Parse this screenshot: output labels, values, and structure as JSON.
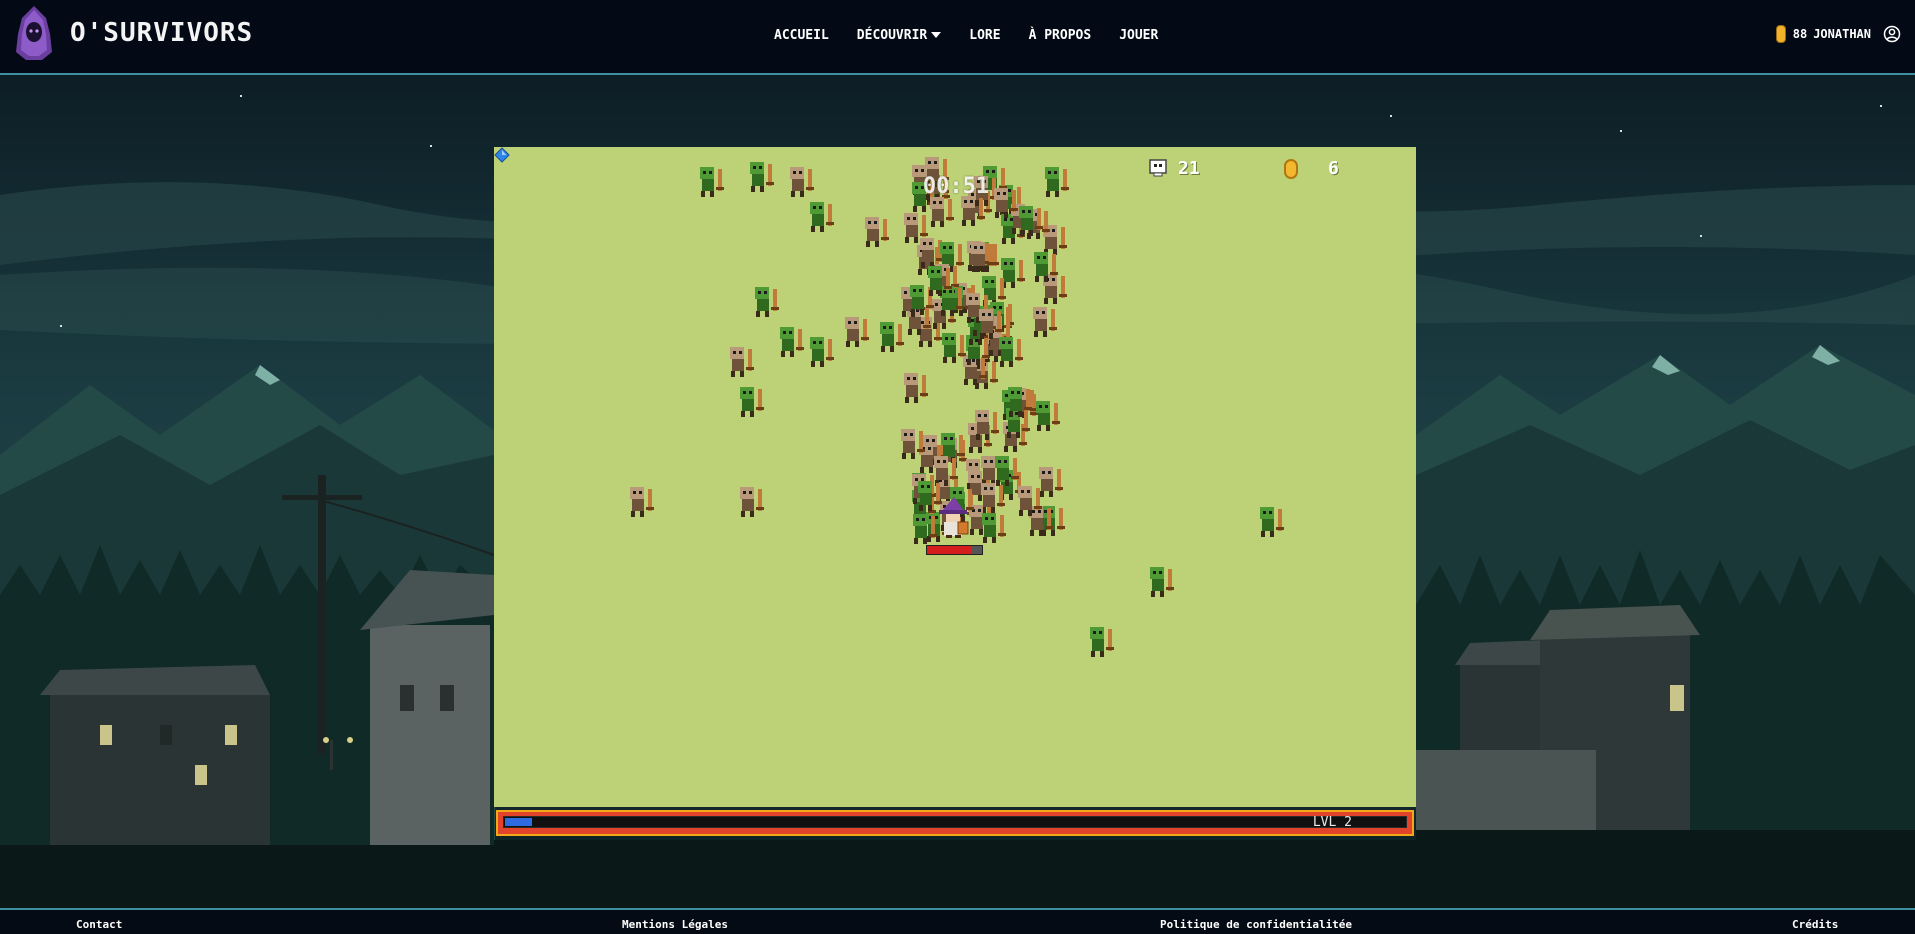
{
  "header": {
    "brand": "O'SURVIVORS",
    "nav": [
      {
        "label": "ACCUEIL"
      },
      {
        "label": "DÉCOUVRIR"
      },
      {
        "label": "LORE"
      },
      {
        "label": "À PROPOS"
      },
      {
        "label": "JOUER"
      }
    ],
    "user": {
      "coins": "88",
      "name": "JONATHAN"
    }
  },
  "game": {
    "timer": "00:51",
    "kills": "21",
    "coins": "6",
    "level_label": "LVL 2",
    "xp_fraction": 0.03,
    "player_hp_fraction": 0.8,
    "colors": {
      "field": "#bdd177",
      "xp": "#2f6be0",
      "hp": "#d41e1e",
      "xp_frame": "#f2a817"
    }
  },
  "footer": {
    "links": [
      "Contact",
      "Mentions Légales",
      "Politique de confidentialitée",
      "Crédits"
    ]
  }
}
